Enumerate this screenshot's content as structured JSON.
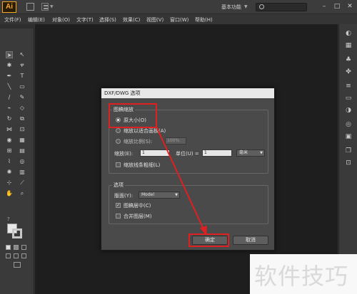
{
  "app": {
    "logo_text": "Ai",
    "workspace": "基本功能"
  },
  "menu": [
    "文件(F)",
    "编辑(E)",
    "对象(O)",
    "文字(T)",
    "选择(S)",
    "效果(C)",
    "视图(V)",
    "窗口(W)",
    "帮助(H)"
  ],
  "dialog": {
    "title": "DXF/DWG 选项",
    "scale_group": {
      "label": "图稿缩放",
      "original_size": "原大小(O)",
      "fit_artboard": "缩放以适合画板(A)",
      "scale_ratio": "缩放比例(S):",
      "scale_ratio_value": "100%",
      "scale_label": "缩放(E):",
      "scale_value": "1",
      "unit_label": "单位(U) =",
      "unit_value": "1",
      "unit_select": "毫米",
      "scale_strokes": "缩放线条粗细(L)"
    },
    "options_group": {
      "label": "选项",
      "layout_label": "版面(Y):",
      "layout_select": "Model",
      "center_art": "图稿居中(C)",
      "merge_layers": "合并图层(M)"
    },
    "ok_button": "确定",
    "cancel_button": "取消"
  },
  "watermark": "软件技巧",
  "colors": {
    "annotation": "#e02020",
    "canvas": "#1e1e1e",
    "ui": "#3a3a3a"
  }
}
